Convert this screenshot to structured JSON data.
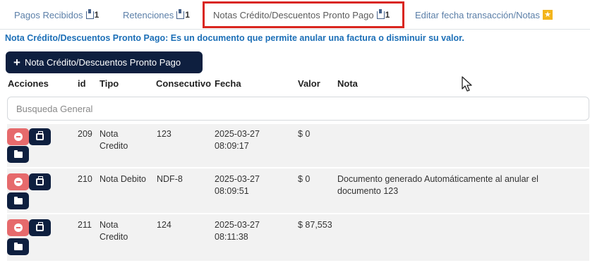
{
  "tabs": [
    {
      "label": "Pagos Recibidos",
      "count": "1"
    },
    {
      "label": "Retenciones",
      "count": "1"
    },
    {
      "label": "Notas Crédito/Descuentos Pronto Pago",
      "count": "1"
    },
    {
      "label": "Editar fecha transacción/Notas"
    }
  ],
  "description": "Nota Crédito/Descuentos Pronto Pago: Es un documento que permite anular una factura o disminuir su valor.",
  "add_button": {
    "label": "Nota Crédito/Descuentos Pronto Pago"
  },
  "columns": [
    "Acciones",
    "id",
    "Tipo",
    "Consecutivo",
    "Fecha",
    "Valor",
    "Nota"
  ],
  "search": {
    "placeholder": "Busqueda General",
    "value": ""
  },
  "rows": [
    {
      "id": "209",
      "tipo": "Nota Credito",
      "consecutivo": "123",
      "fecha_date": "2025-03-27",
      "fecha_time": "08:09:17",
      "valor": "$ 0",
      "nota": ""
    },
    {
      "id": "210",
      "tipo": "Nota Debito",
      "consecutivo": "NDF-8",
      "fecha_date": "2025-03-27",
      "fecha_time": "08:09:51",
      "valor": "$ 0",
      "nota": "Documento generado Automáticamente al anular el documento 123"
    },
    {
      "id": "211",
      "tipo": "Nota Credito",
      "consecutivo": "124",
      "fecha_date": "2025-03-27",
      "fecha_time": "08:11:38",
      "valor": "$ 87,553",
      "nota": ""
    }
  ],
  "icons": [
    "tab-count-icon",
    "star-icon",
    "plus-icon",
    "delete-icon",
    "print-icon",
    "folder-icon",
    "mouse-cursor-icon"
  ],
  "colors": {
    "primary": "#0e1f3f",
    "delete": "#e66a6c",
    "link": "#1c6fb7",
    "highlight": "#d9261f",
    "star": "#f3b51c"
  }
}
